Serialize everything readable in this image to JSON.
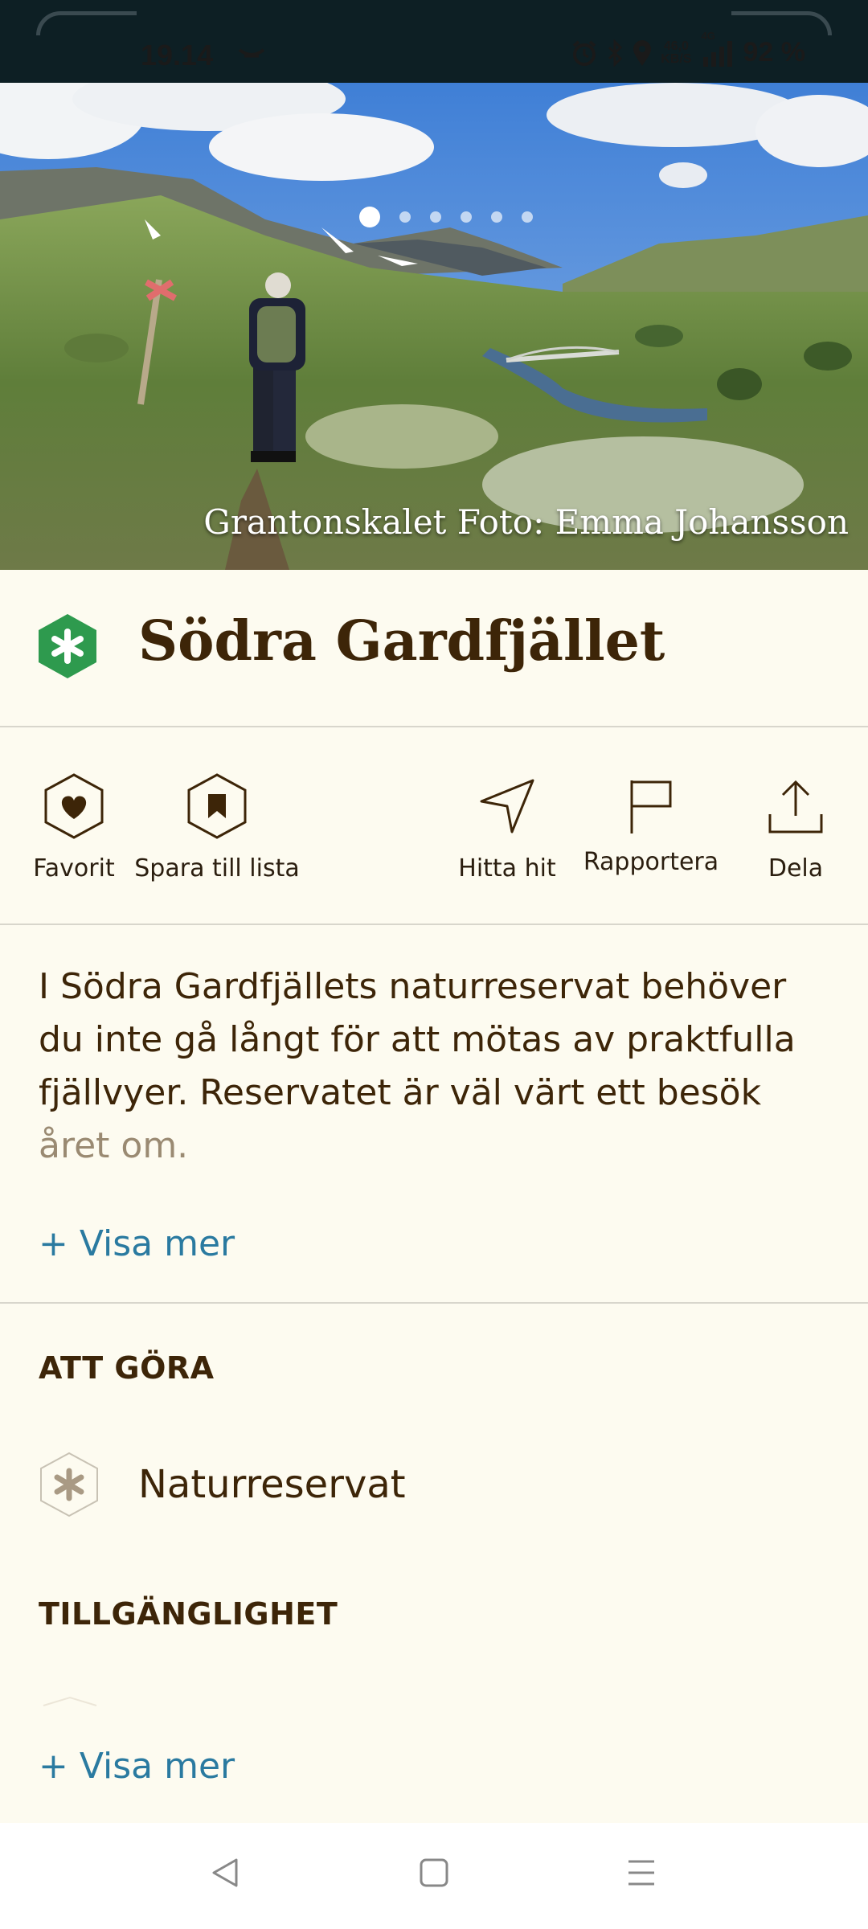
{
  "status_bar": {
    "time": "19.14",
    "network_speed_value": "46,0",
    "network_speed_unit": "KB/S",
    "network_type": "4G",
    "battery": "92 %"
  },
  "hero": {
    "caption": "Grantonskalet Foto: Emma Johansson",
    "image_count": 6,
    "active_index": 0
  },
  "place": {
    "title": "Södra Gardfjället",
    "icon": "nature-reserve-icon",
    "icon_color": "#2e9a4e"
  },
  "actions": {
    "favorite": "Favorit",
    "save_to_list": "Spara till lista",
    "find_here": "Hitta hit",
    "report": "Rapportera",
    "share": "Dela"
  },
  "description": {
    "text_main": "I Södra Gardfjällets naturreservat behöver du inte gå långt för att mötas av praktfulla fjällvyer. Reservatet är väl värt ett besök",
    "text_faded": "året om.",
    "show_more": "+ Visa mer"
  },
  "things_to_do": {
    "heading": "ATT GÖRA",
    "items": [
      {
        "label": "Naturreservat",
        "icon": "nature-reserve-icon"
      }
    ]
  },
  "accessibility": {
    "heading": "TILLGÄNGLIGHET",
    "show_more": "+ Visa mer"
  },
  "colors": {
    "background": "#fdfbf0",
    "text": "#3d2508",
    "link": "#2a7aa0",
    "accent_green": "#2e9a4e"
  }
}
